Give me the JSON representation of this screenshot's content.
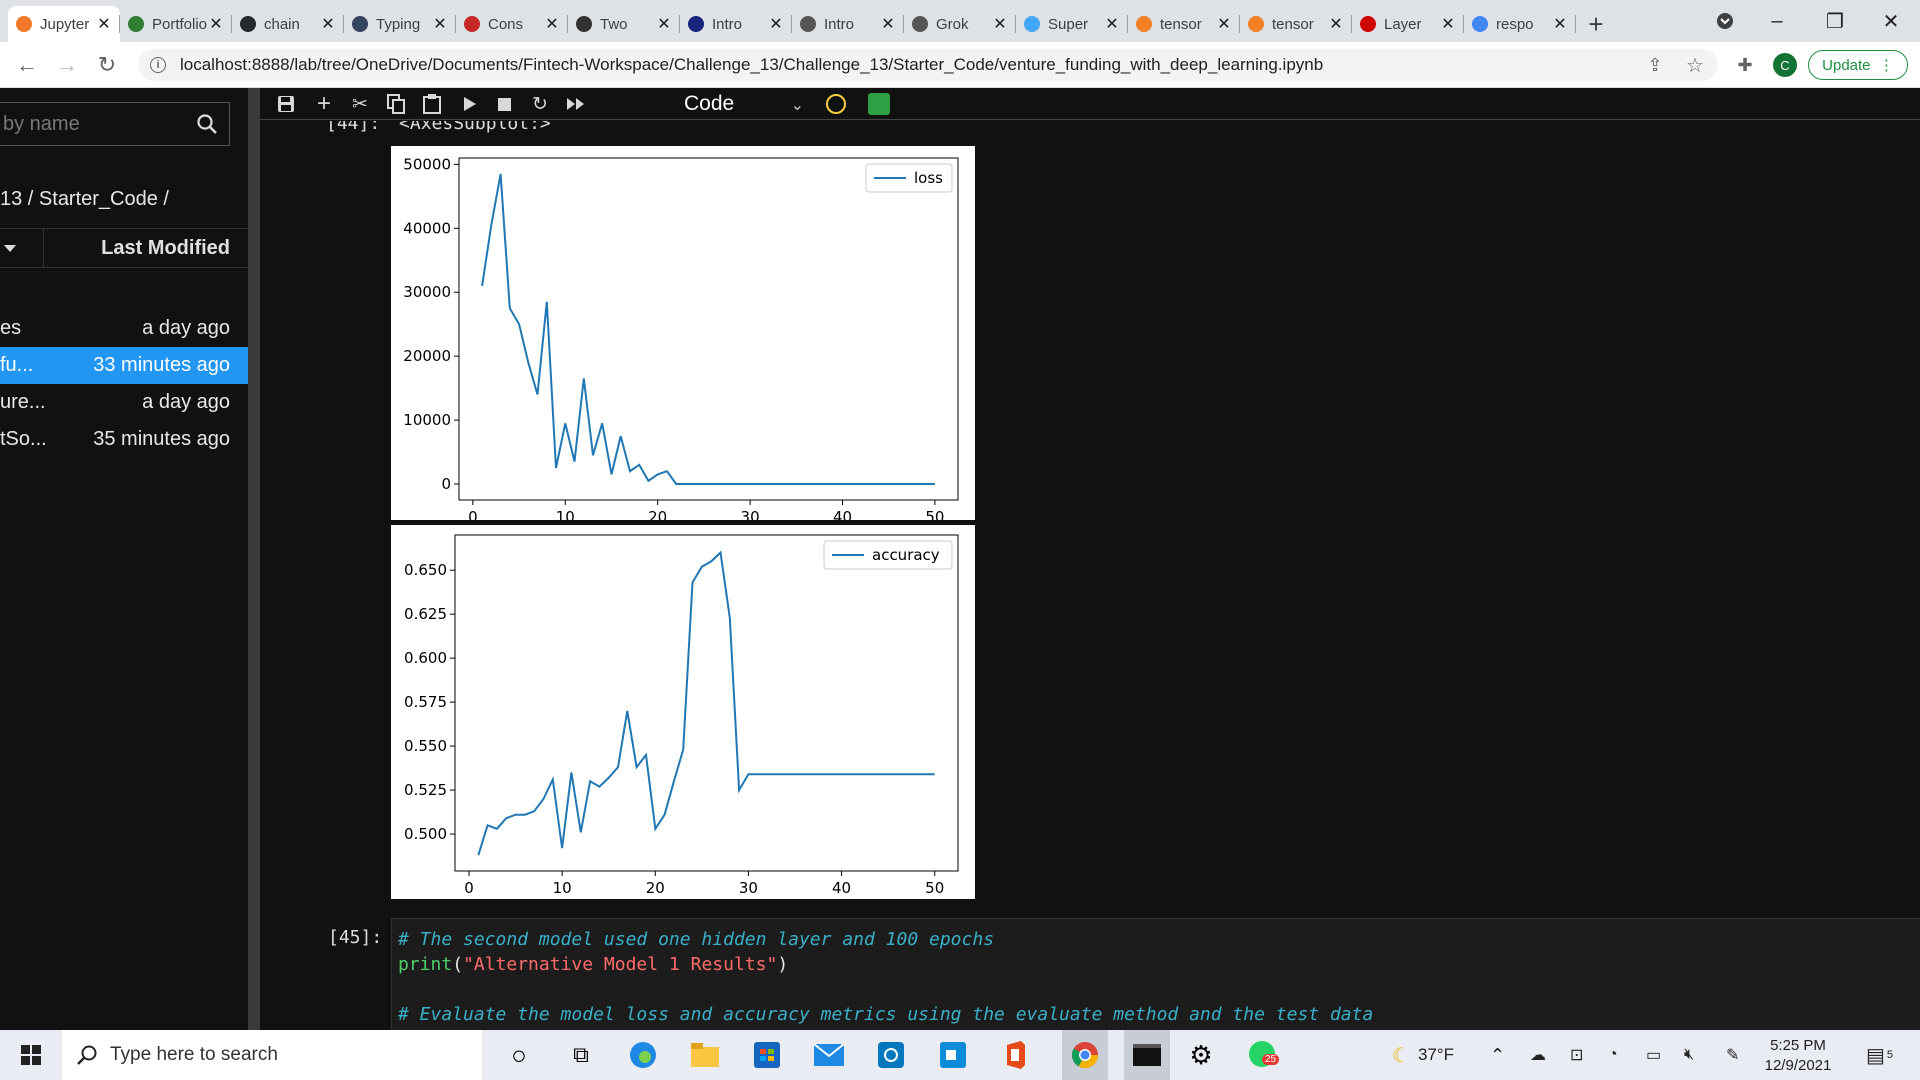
{
  "browser": {
    "tabs": [
      {
        "label": "Jupyter",
        "icon": "jupyter-icon",
        "color": "#f37726",
        "active": true
      },
      {
        "label": "Portfolio",
        "icon": "feather-icon",
        "color": "#2e7d32"
      },
      {
        "label": "chain",
        "icon": "github-icon",
        "color": "#24292e"
      },
      {
        "label": "Typing",
        "icon": "tumblr-icon",
        "color": "#35465c"
      },
      {
        "label": "Cons",
        "icon": "gs-icon",
        "color": "#c62828"
      },
      {
        "label": "Two",
        "icon": "tab-icon",
        "color": "#333333"
      },
      {
        "label": "Intro",
        "icon": "v-icon",
        "color": "#1a237e"
      },
      {
        "label": "Intro",
        "icon": "globe-icon",
        "color": "#555555"
      },
      {
        "label": "Grok",
        "icon": "globe-icon",
        "color": "#555555"
      },
      {
        "label": "Super",
        "icon": "bird-icon",
        "color": "#42a5f5"
      },
      {
        "label": "tensor",
        "icon": "stack-icon",
        "color": "#f48024"
      },
      {
        "label": "tensor",
        "icon": "stack-icon",
        "color": "#f48024"
      },
      {
        "label": "Layer",
        "icon": "k-icon",
        "color": "#d00000"
      },
      {
        "label": "respo",
        "icon": "google-icon",
        "color": "#4285f4"
      }
    ],
    "url": "localhost:8888/lab/tree/OneDrive/Documents/Fintech-Workspace/Challenge_13/Challenge_13/Starter_Code/venture_funding_with_deep_learning.ipynb",
    "profile_initial": "C",
    "update_label": "Update"
  },
  "sidebar": {
    "filter_placeholder": "by name",
    "breadcrumb": "13 / Starter_Code /",
    "col_modified": "Last Modified",
    "files": [
      {
        "name": "es",
        "modified": "a day ago"
      },
      {
        "name": "fu...",
        "modified": "33 minutes ago",
        "selected": true
      },
      {
        "name": "ure...",
        "modified": "a day ago"
      },
      {
        "name": "tSo...",
        "modified": "35 minutes ago"
      }
    ]
  },
  "toolbar": {
    "cell_type": "Code"
  },
  "notebook": {
    "output_prompt": "[44]:",
    "output_text": "<AxesSubplot:>",
    "input_prompt": "[45]:",
    "code_line1": "# The second model used one hidden layer and 100 epochs",
    "code_print": "print",
    "code_str": "\"Alternative Model 1 Results\"",
    "code_line3": "# Evaluate the model loss and accuracy metrics using the evaluate method and the test data"
  },
  "chart_data": [
    {
      "type": "line",
      "series": [
        {
          "name": "loss",
          "color": "#1f77b4"
        }
      ],
      "x": [
        1,
        2,
        3,
        4,
        5,
        6,
        7,
        8,
        9,
        10,
        11,
        12,
        13,
        14,
        15,
        16,
        17,
        18,
        19,
        20,
        21,
        22,
        23,
        24,
        25,
        26,
        27,
        28,
        29,
        30,
        31,
        32,
        33,
        34,
        35,
        36,
        37,
        38,
        39,
        40,
        41,
        42,
        43,
        44,
        45,
        46,
        47,
        48,
        49,
        50
      ],
      "y": [
        31000,
        40500,
        48500,
        27500,
        25000,
        19000,
        14000,
        28500,
        2500,
        9500,
        3500,
        16500,
        4500,
        9500,
        1500,
        7500,
        2000,
        3000,
        500,
        1500,
        2000,
        0,
        0,
        0,
        0,
        0,
        0,
        0,
        0,
        0,
        0,
        0,
        0,
        0,
        0,
        0,
        0,
        0,
        0,
        0,
        0,
        0,
        0,
        0,
        0,
        0,
        0,
        0,
        0,
        0
      ],
      "xticks": [
        0,
        10,
        20,
        30,
        40,
        50
      ],
      "yticks": [
        0,
        10000,
        20000,
        30000,
        40000,
        50000
      ],
      "xlim": [
        -1.5,
        52.5
      ],
      "ylim": [
        -2500,
        51000
      ],
      "legend": "upper right"
    },
    {
      "type": "line",
      "series": [
        {
          "name": "accuracy",
          "color": "#1f77b4"
        }
      ],
      "x": [
        1,
        2,
        3,
        4,
        5,
        6,
        7,
        8,
        9,
        10,
        11,
        12,
        13,
        14,
        15,
        16,
        17,
        18,
        19,
        20,
        21,
        22,
        23,
        24,
        25,
        26,
        27,
        28,
        29,
        30,
        31,
        32,
        33,
        34,
        35,
        36,
        37,
        38,
        39,
        40,
        41,
        42,
        43,
        44,
        45,
        46,
        47,
        48,
        49,
        50
      ],
      "y": [
        0.488,
        0.505,
        0.503,
        0.509,
        0.511,
        0.511,
        0.513,
        0.52,
        0.531,
        0.492,
        0.535,
        0.501,
        0.53,
        0.527,
        0.532,
        0.538,
        0.57,
        0.538,
        0.545,
        0.503,
        0.511,
        0.53,
        0.548,
        0.643,
        0.652,
        0.655,
        0.66,
        0.623,
        0.525,
        0.534,
        0.534,
        0.534,
        0.534,
        0.534,
        0.534,
        0.534,
        0.534,
        0.534,
        0.534,
        0.534,
        0.534,
        0.534,
        0.534,
        0.534,
        0.534,
        0.534,
        0.534,
        0.534,
        0.534,
        0.534
      ],
      "xticks": [
        0,
        10,
        20,
        30,
        40,
        50
      ],
      "yticks": [
        0.5,
        0.525,
        0.55,
        0.575,
        0.6,
        0.625,
        0.65
      ],
      "xlim": [
        -1.5,
        52.5
      ],
      "ylim": [
        0.479,
        0.67
      ],
      "legend": "upper right"
    }
  ],
  "taskbar": {
    "search_placeholder": "Type here to search",
    "weather": "37°F",
    "time": "5:25 PM",
    "date": "12/9/2021",
    "whatsapp_badge": "25",
    "notifications": "5"
  }
}
